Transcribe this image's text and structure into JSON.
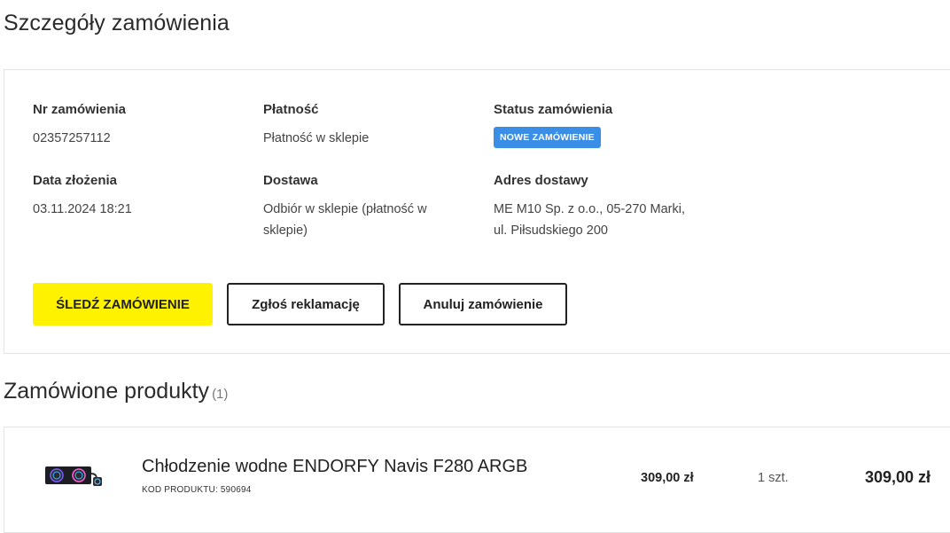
{
  "page_title": "Szczegóły zamówienia",
  "order": {
    "number_label": "Nr zamówienia",
    "number_value": "02357257112",
    "payment_label": "Płatność",
    "payment_value": "Płatność w sklepie",
    "status_label": "Status zamówienia",
    "status_value": "NOWE ZAMÓWIENIE",
    "date_label": "Data złożenia",
    "date_value": "03.11.2024 18:21",
    "delivery_label": "Dostawa",
    "delivery_value_line1": "Odbiór w sklepie (płatność w",
    "delivery_value_line2": "sklepie)",
    "address_label": "Adres dostawy",
    "address_line1": "ME M10 Sp. z o.o., 05-270 Marki,",
    "address_line2": "ul. Piłsudskiego 200"
  },
  "actions": {
    "track": "ŚLEDŹ ZAMÓWIENIE",
    "complaint": "Zgłoś reklamację",
    "cancel": "Anuluj zamówienie"
  },
  "products_section": {
    "title": "Zamówione produkty",
    "count": "(1)"
  },
  "products": [
    {
      "name": "Chłodzenie wodne ENDORFY Navis F280 ARGB",
      "code": "KOD PRODUKTU: 590694",
      "unit_price": "309,00 zł",
      "quantity": "1 szt.",
      "total": "309,00 zł"
    }
  ],
  "colors": {
    "primary_button": "#fff200",
    "status_badge": "#3a8ee6"
  }
}
